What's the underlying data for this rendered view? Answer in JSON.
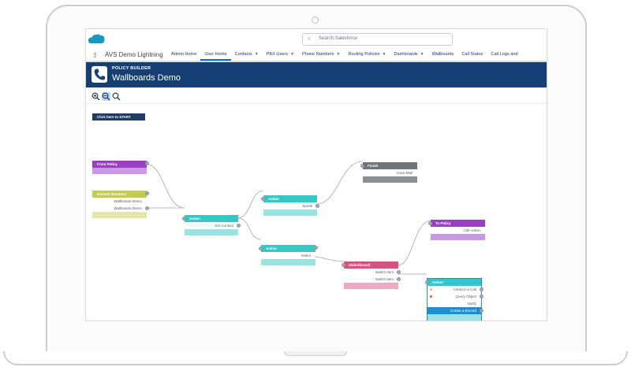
{
  "search": {
    "placeholder": "Search Salesforce"
  },
  "app": {
    "name": "AVS Demo Lightning"
  },
  "nav": {
    "items": [
      {
        "label": "Admin Home",
        "dropdown": false,
        "active": false
      },
      {
        "label": "User Home",
        "dropdown": false,
        "active": true
      },
      {
        "label": "Contacts",
        "dropdown": true,
        "active": false
      },
      {
        "label": "PBX Users",
        "dropdown": true,
        "active": false
      },
      {
        "label": "Phone Numbers",
        "dropdown": true,
        "active": false
      },
      {
        "label": "Routing Policies",
        "dropdown": true,
        "active": false
      },
      {
        "label": "Dashboards",
        "dropdown": true,
        "active": false
      },
      {
        "label": "Wallboards",
        "dropdown": false,
        "active": false
      },
      {
        "label": "Call Status",
        "dropdown": false,
        "active": false
      },
      {
        "label": "Call Logs and",
        "dropdown": false,
        "active": false
      }
    ]
  },
  "header": {
    "eyebrow": "POLICY BUILDER",
    "title": "Wallboards Demo"
  },
  "toolbar": {
    "zoom_in": "⊕",
    "zoom_reset": "⊖",
    "zoom_search": "🔍"
  },
  "start_button": "Click here to START",
  "nodes": {
    "from_policy": {
      "title": "From Policy",
      "color": "#9a3fc4",
      "foot": "#cb98e4"
    },
    "domain_numbers": {
      "title": "Domain Numbers",
      "color": "#c2cb52",
      "rows": [
        "Wallboards Demo",
        "Wallboards Demo"
      ],
      "foot": "#e3e8a8"
    },
    "action1": {
      "title": "Action",
      "color": "#33c8c4",
      "rows": [
        "Get Contact"
      ],
      "foot": "#99e4e2"
    },
    "action2": {
      "title": "Action",
      "color": "#33c8c4",
      "rows": [
        "Speak"
      ],
      "foot": "#99e4e2"
    },
    "finish": {
      "title": "Finish",
      "color": "#6f7277",
      "rows": [
        "Voice Mail"
      ],
      "foot": "#8b8e92"
    },
    "action3": {
      "title": "Action",
      "color": "#33c8c4",
      "rows": [
        "Select"
      ],
      "foot": "#99e4e2"
    },
    "to_policy": {
      "title": "To Policy",
      "color": "#9a3fc4",
      "rows": [
        "Call Admin"
      ],
      "foot": "#cb98e4"
    },
    "switchboard": {
      "title": "Switchboard",
      "color": "#d9517c",
      "rows": [
        "Switch Item",
        "Switch Item"
      ],
      "foot": "#eea9c0"
    },
    "action4": {
      "title": "Action",
      "color": "#33c8c4",
      "rows": [
        "Connect a Call",
        "Query Object",
        "Notify"
      ],
      "highlight": "Create a Record",
      "foot": "#99e4e2"
    }
  }
}
